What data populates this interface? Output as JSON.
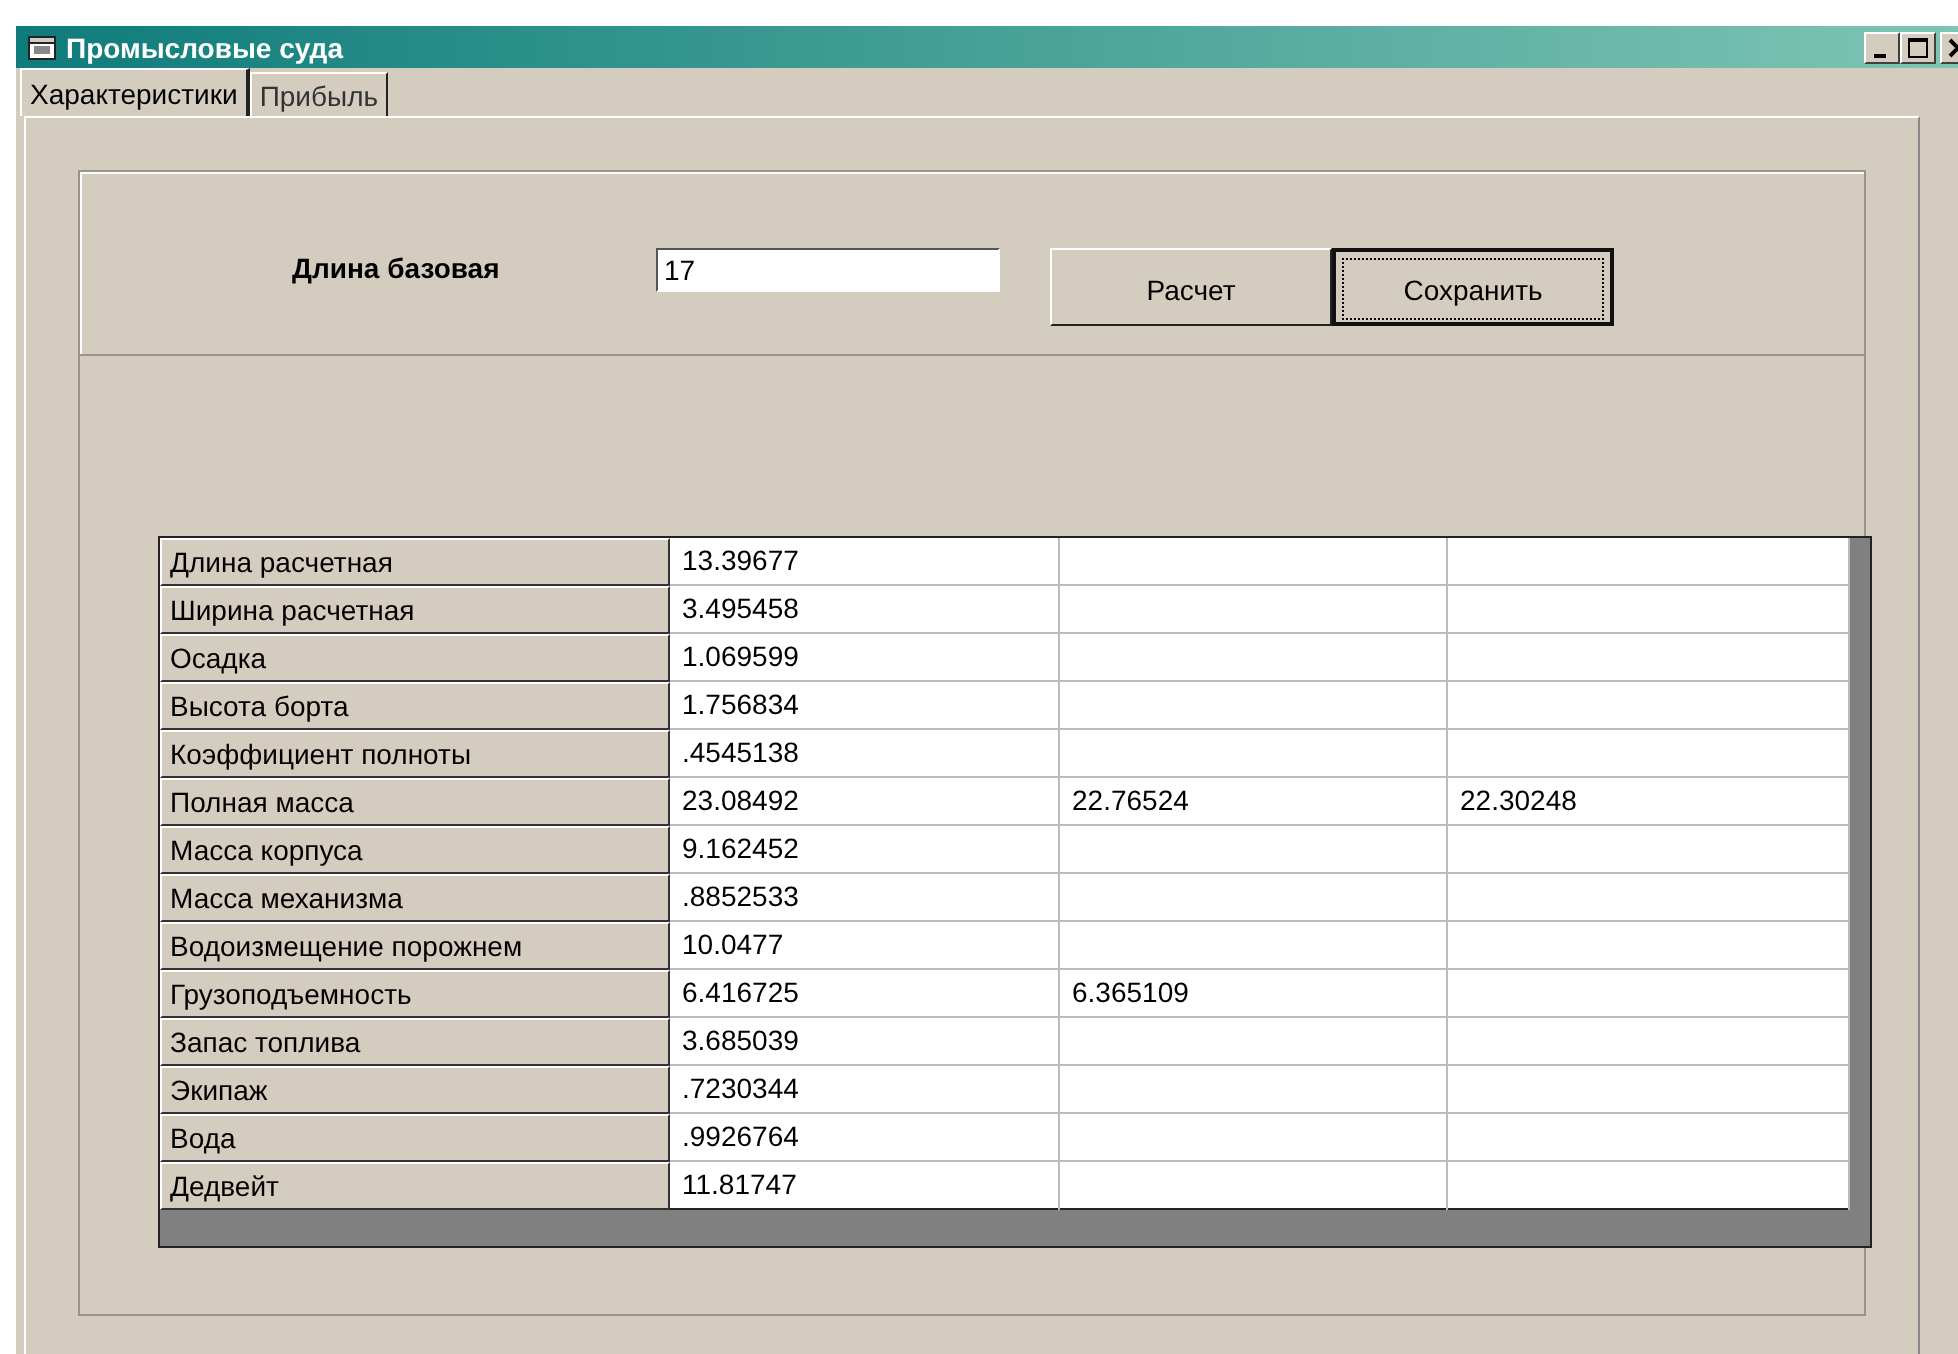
{
  "window": {
    "title": "Промысловые суда"
  },
  "tabs": [
    {
      "label": "Характеристики",
      "selected": true
    },
    {
      "label": "Прибыль",
      "selected": false
    }
  ],
  "form": {
    "label": "Длина базовая",
    "value": "17"
  },
  "buttons": [
    {
      "label": "Расчет",
      "focused": false
    },
    {
      "label": "Сохранить",
      "focused": true
    }
  ],
  "table": {
    "rows": [
      {
        "label": "Длина расчетная",
        "values": [
          "13.39677"
        ]
      },
      {
        "label": "Ширина расчетная",
        "values": [
          "3.495458"
        ]
      },
      {
        "label": "Осадка",
        "values": [
          "1.069599"
        ]
      },
      {
        "label": "Высота борта",
        "values": [
          "1.756834"
        ]
      },
      {
        "label": "Коэффициент полноты",
        "values": [
          ".4545138"
        ]
      },
      {
        "label": "Полная масса",
        "values": [
          "23.08492",
          "22.76524",
          "22.30248"
        ]
      },
      {
        "label": "Масса корпуса",
        "values": [
          "9.162452"
        ]
      },
      {
        "label": "Масса механизма",
        "values": [
          ".8852533"
        ]
      },
      {
        "label": "Водоизмещение порожнем",
        "values": [
          "10.0477"
        ]
      },
      {
        "label": "Грузоподъемность",
        "values": [
          "6.416725",
          "6.365109"
        ]
      },
      {
        "label": "Запас топлива",
        "values": [
          "3.685039"
        ]
      },
      {
        "label": "Экипаж",
        "values": [
          ".7230344"
        ]
      },
      {
        "label": "Вода",
        "values": [
          ".9926764"
        ]
      },
      {
        "label": "Дедвейт",
        "values": [
          "11.81747"
        ]
      }
    ]
  }
}
